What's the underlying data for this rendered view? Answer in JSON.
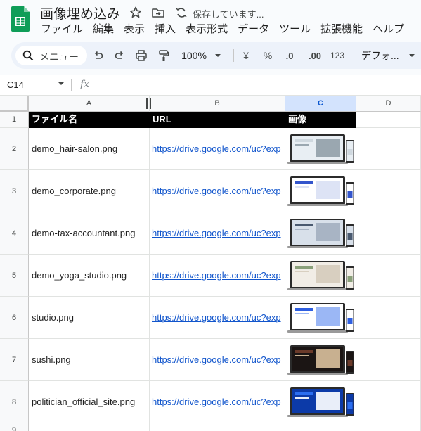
{
  "app": {
    "doc_title": "画像埋め込み",
    "status": "保存しています...",
    "menu": [
      "ファイル",
      "編集",
      "表示",
      "挿入",
      "表示形式",
      "データ",
      "ツール",
      "拡張機能",
      "ヘルプ"
    ]
  },
  "toolbar": {
    "search_label": "メニュー",
    "zoom": "100%",
    "currency": "¥",
    "percent": "%",
    "dec_decrease": ".0",
    "dec_increase": ".00",
    "number_format": "123",
    "font": "デフォ..."
  },
  "formula_bar": {
    "cell_ref": "C14",
    "fx": "fx",
    "value": ""
  },
  "columns": [
    "A",
    "B",
    "C",
    "D"
  ],
  "header_row": {
    "row": "1",
    "cells": [
      "ファイル名",
      "URL",
      "画像",
      ""
    ]
  },
  "rows": [
    {
      "num": "2",
      "file": "demo_hair-salon.png",
      "url": "https://drive.google.com/uc?exp",
      "image": "hair-salon-mockup"
    },
    {
      "num": "3",
      "file": "demo_corporate.png",
      "url": "https://drive.google.com/uc?exp",
      "image": "corporate-mockup"
    },
    {
      "num": "4",
      "file": "demo-tax-accountant.png",
      "url": "https://drive.google.com/uc?exp",
      "image": "tax-accountant-mockup"
    },
    {
      "num": "5",
      "file": "demo_yoga_studio.png",
      "url": "https://drive.google.com/uc?exp",
      "image": "yoga-studio-mockup"
    },
    {
      "num": "6",
      "file": "studio.png",
      "url": "https://drive.google.com/uc?exp",
      "image": "studio-mockup"
    },
    {
      "num": "7",
      "file": "sushi.png",
      "url": "https://drive.google.com/uc?exp",
      "image": "sushi-mockup"
    },
    {
      "num": "8",
      "file": "politician_official_site.png",
      "url": "https://drive.google.com/uc?exp",
      "image": "politician-mockup"
    }
  ],
  "last_row_num": "9",
  "colors": {
    "header_bg": "#000000",
    "selected_col": "#d3e3fd",
    "link": "#1155cc",
    "sheets_green": "#0f9d58"
  }
}
